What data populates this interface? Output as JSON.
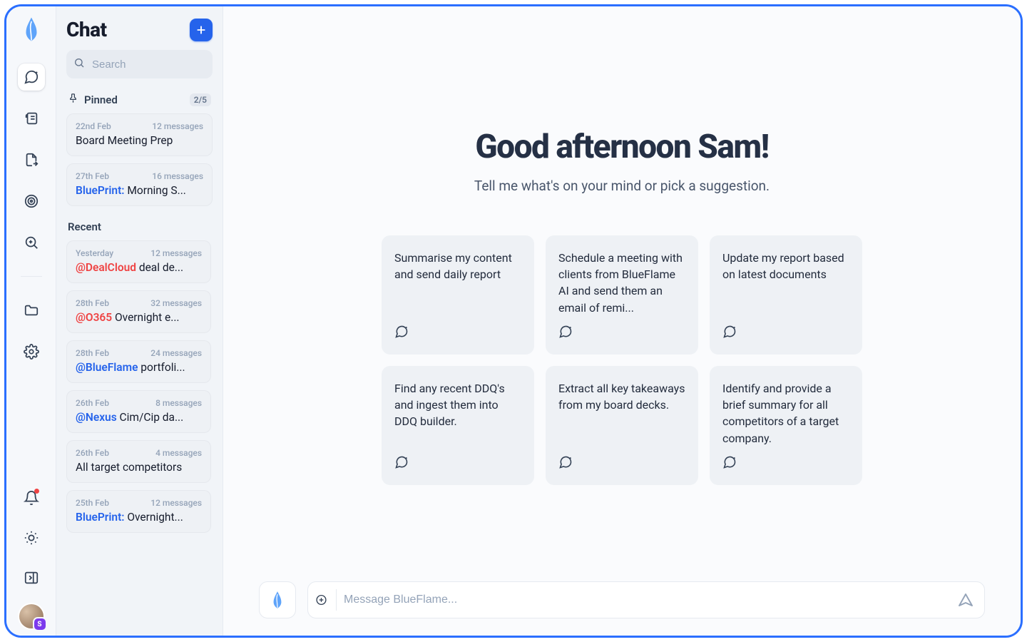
{
  "sidebar_title": "Chat",
  "search_placeholder": "Search",
  "pinned": {
    "label": "Pinned",
    "count": "2/5",
    "items": [
      {
        "date": "22nd Feb",
        "msgcount": "12 messages",
        "prefix": "",
        "prefix_class": "",
        "title": "Board Meeting Prep"
      },
      {
        "date": "27th Feb",
        "msgcount": "16 messages",
        "prefix": "BluePrint:",
        "prefix_class": "prefix-blue",
        "title": " Morning S..."
      }
    ]
  },
  "recent": {
    "label": "Recent",
    "items": [
      {
        "date": "Yesterday",
        "msgcount": "12 messages",
        "prefix": "@DealCloud",
        "prefix_class": "prefix-red",
        "title": " deal de..."
      },
      {
        "date": "28th Feb",
        "msgcount": "32 messages",
        "prefix": "@O365",
        "prefix_class": "prefix-red",
        "title": " Overnight e..."
      },
      {
        "date": "28th Feb",
        "msgcount": "24 messages",
        "prefix": "@BlueFlame",
        "prefix_class": "prefix-blue",
        "title": " portfoli..."
      },
      {
        "date": "26th Feb",
        "msgcount": "8 messages",
        "prefix": "@Nexus",
        "prefix_class": "prefix-blue",
        "title": " Cim/Cip da..."
      },
      {
        "date": "26th Feb",
        "msgcount": "4 messages",
        "prefix": "",
        "prefix_class": "",
        "title": "All target competitors"
      },
      {
        "date": "25th Feb",
        "msgcount": "12 messages",
        "prefix": "BluePrint:",
        "prefix_class": "prefix-blue",
        "title": " Overnight..."
      }
    ]
  },
  "greeting": "Good afternoon Sam!",
  "sub_greeting": "Tell me what's on your mind or pick a suggestion.",
  "suggestions": [
    "Summarise my content and send daily report",
    "Schedule a meeting with clients from BlueFlame AI and send them an email of remi...",
    "Update my report based on latest documents",
    "Find any recent DDQ's and ingest them into DDQ builder.",
    "Extract all key takeaways from my board decks.",
    "Identify and provide a brief summary for all competitors of a target company."
  ],
  "input_placeholder": "Message BlueFlame...",
  "avatar_badge": "S"
}
